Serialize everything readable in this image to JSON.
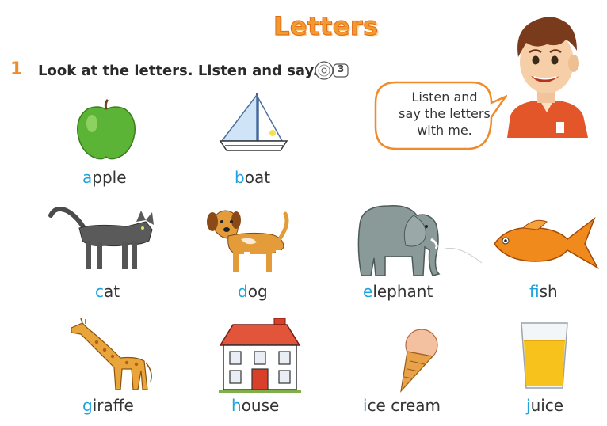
{
  "title": "Letters",
  "exercise": {
    "number": "1",
    "instruction": "Look at the letters. Listen and say.",
    "track": "3"
  },
  "bubble": {
    "lines": [
      "Listen and",
      "say the letters",
      "with me."
    ]
  },
  "items": [
    {
      "first": "a",
      "rest": "pple",
      "icon": "apple-icon"
    },
    {
      "first": "b",
      "rest": "oat",
      "icon": "boat-icon"
    },
    {
      "first": "c",
      "rest": "at",
      "icon": "cat-icon"
    },
    {
      "first": "d",
      "rest": "og",
      "icon": "dog-icon"
    },
    {
      "first": "e",
      "rest": "lephant",
      "icon": "elephant-icon"
    },
    {
      "first": "f",
      "rest": "ish",
      "icon": "fish-icon"
    },
    {
      "first": "g",
      "rest": "iraffe",
      "icon": "giraffe-icon"
    },
    {
      "first": "h",
      "rest": "ouse",
      "icon": "house-icon"
    },
    {
      "first": "i",
      "rest": "ce cream",
      "icon": "ice-cream-icon"
    },
    {
      "first": "j",
      "rest": "uice",
      "icon": "juice-icon"
    }
  ],
  "colors": {
    "accent": "#f08a2a",
    "first_letter": "#1da3dd",
    "text": "#333333"
  }
}
